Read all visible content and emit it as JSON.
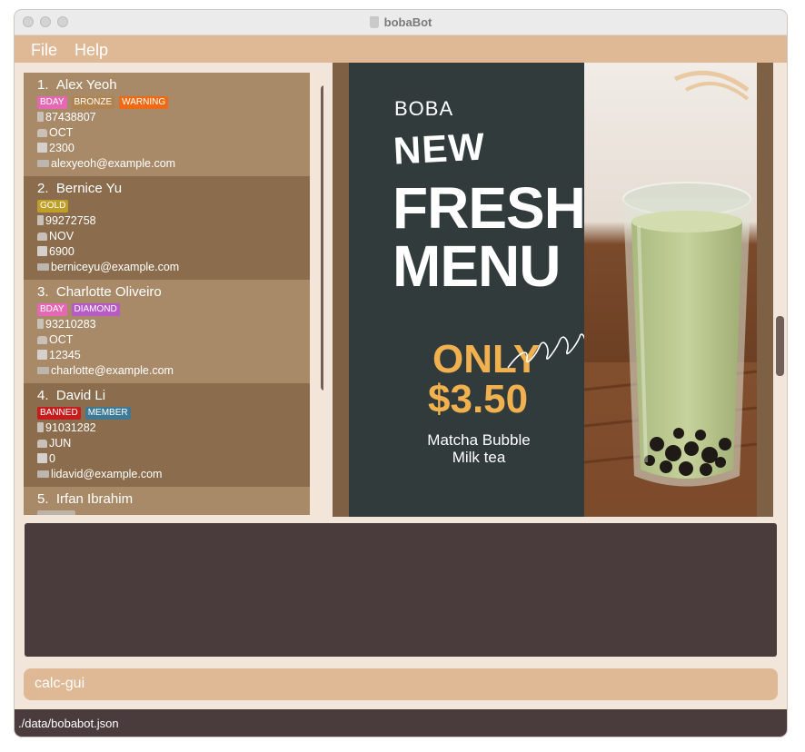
{
  "window": {
    "title": "bobaBot",
    "icon": "boba-cup-icon"
  },
  "menu": {
    "file": "File",
    "help": "Help"
  },
  "customers": [
    {
      "index": "1.",
      "name": "Alex Yeoh",
      "tags": [
        {
          "label": "BDAY",
          "color": "#e667b2"
        },
        {
          "label": "BRONZE",
          "color": "#b0834f"
        },
        {
          "label": "WARNING",
          "color": "#f06a13"
        }
      ],
      "phone": "87438807",
      "birthday": "OCT",
      "points": "2300",
      "email": "alexyeoh@example.com"
    },
    {
      "index": "2.",
      "name": "Bernice Yu",
      "tags": [
        {
          "label": "GOLD",
          "color": "#bf9f27"
        }
      ],
      "phone": "99272758",
      "birthday": "NOV",
      "points": "6900",
      "email": "berniceyu@example.com"
    },
    {
      "index": "3.",
      "name": "Charlotte Oliveiro",
      "tags": [
        {
          "label": "BDAY",
          "color": "#e667b2"
        },
        {
          "label": "DIAMOND",
          "color": "#b75ac6"
        }
      ],
      "phone": "93210283",
      "birthday": "OCT",
      "points": "12345",
      "email": "charlotte@example.com"
    },
    {
      "index": "4.",
      "name": "David Li",
      "tags": [
        {
          "label": "BANNED",
          "color": "#c81c1c"
        },
        {
          "label": "MEMBER",
          "color": "#3f7a95"
        }
      ],
      "phone": "91031282",
      "birthday": "JUN",
      "points": "0",
      "email": "lidavid@example.com"
    },
    {
      "index": "5.",
      "name": "Irfan Ibrahim"
    }
  ],
  "poster": {
    "brand": "BOBA",
    "headline_1": "NEW",
    "headline_2": "FRESH",
    "headline_3": "MENU",
    "offer": "ONLY",
    "price": "$3.50",
    "product_line_1": "Matcha Bubble",
    "product_line_2": "Milk tea"
  },
  "command": {
    "value": "calc-gui"
  },
  "status_bar": {
    "path": "./data/bobabot.json"
  }
}
